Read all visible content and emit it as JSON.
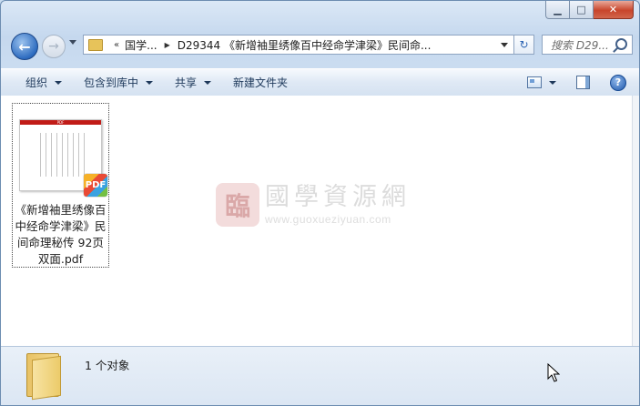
{
  "window": {
    "caption": {
      "minimize": "▁",
      "maximize": "□",
      "close": "✕"
    }
  },
  "nav": {
    "back_glyph": "←",
    "forward_glyph": "→",
    "address": {
      "overflow": "«",
      "crumbs": [
        "国学...",
        "D29344 《新增袖里绣像百中经命学津梁》民间命..."
      ]
    },
    "refresh_glyph": "↻",
    "search_placeholder": "搜索 D29..."
  },
  "commands": [
    {
      "label": "组织",
      "dropdown": true
    },
    {
      "label": "包含到库中",
      "dropdown": true
    },
    {
      "label": "共享",
      "dropdown": true
    },
    {
      "label": "新建文件夹",
      "dropdown": false
    }
  ],
  "commands_right": {
    "help_glyph": "?"
  },
  "files": [
    {
      "name": "《新增袖里绣像百中经命学津梁》民间命理秘传 92页 双面.pdf",
      "thumb_header": "PDF",
      "badge": "PDF"
    }
  ],
  "watermark": {
    "logo_glyph": "臨",
    "title": "國學資源網",
    "url": "www.guoxueziyuan.com"
  },
  "details": {
    "status": "1 个对象"
  },
  "colors": {
    "accent": "#2e6cc0",
    "close": "#c8452b"
  }
}
